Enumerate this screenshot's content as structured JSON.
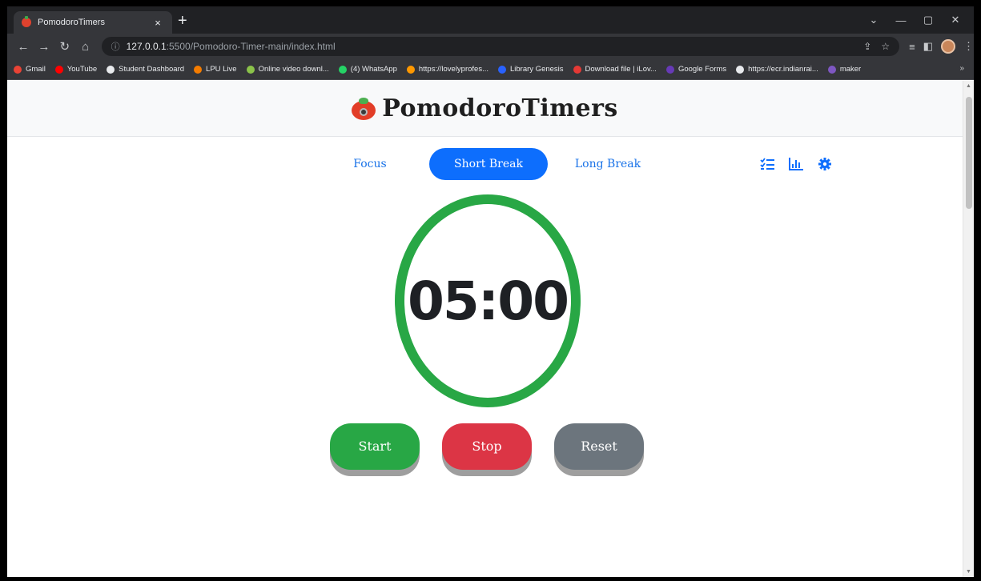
{
  "browser": {
    "tab_title": "PomodoroTimers",
    "tab_close": "×",
    "new_tab": "+",
    "win_min": "—",
    "win_max": "▢",
    "win_close": "✕",
    "win_menu": "⌄",
    "address_host": "127.0.0.1",
    "address_path": ":5500/Pomodoro-Timer-main/index.html",
    "address_info": "ⓘ",
    "bookmarks": [
      {
        "label": "Gmail",
        "color": "#ea4335"
      },
      {
        "label": "YouTube",
        "color": "#ff0000"
      },
      {
        "label": "Student Dashboard",
        "color": "#e8eaed"
      },
      {
        "label": "LPU Live",
        "color": "#f57c00"
      },
      {
        "label": "Online video downl...",
        "color": "#8bc34a"
      },
      {
        "label": "(4) WhatsApp",
        "color": "#25d366"
      },
      {
        "label": "https://lovelyprofes...",
        "color": "#ff9800"
      },
      {
        "label": "Library Genesis",
        "color": "#2962ff"
      },
      {
        "label": "Download file | iLov...",
        "color": "#e53935"
      },
      {
        "label": "Google Forms",
        "color": "#673ab7"
      },
      {
        "label": "https://ecr.indianrai...",
        "color": "#e8eaed"
      },
      {
        "label": "maker",
        "color": "#7e57c2"
      }
    ],
    "bookmarks_more": "»"
  },
  "app": {
    "title": "PomodoroTimers",
    "tabs": [
      {
        "label": "Focus",
        "active": false
      },
      {
        "label": "Short Break",
        "active": true
      },
      {
        "label": "Long Break",
        "active": false
      }
    ],
    "timer": "05:00",
    "buttons": {
      "start": "Start",
      "stop": "Stop",
      "reset": "Reset"
    },
    "colors": {
      "accent": "#0d6efd",
      "ring": "#28a745",
      "start": "#28a745",
      "stop": "#dc3545",
      "reset": "#6c757d"
    },
    "icons": [
      "task-list-icon",
      "bar-chart-icon",
      "gear-icon"
    ]
  }
}
